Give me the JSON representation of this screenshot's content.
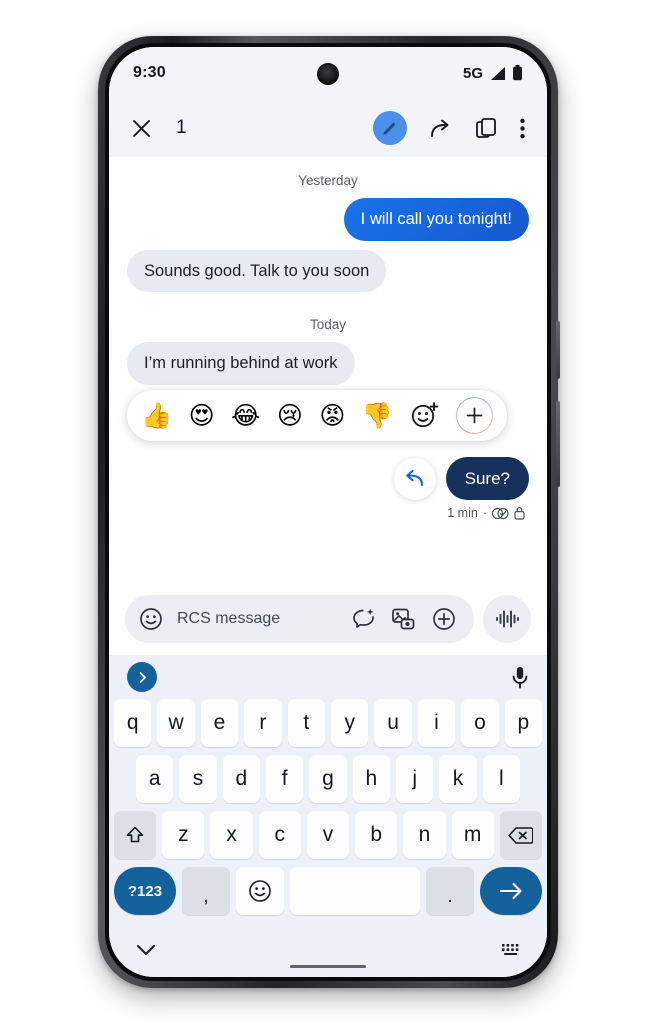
{
  "status_bar": {
    "time": "9:30",
    "network": "5G",
    "signal_icon": "signal-bars-icon",
    "battery_icon": "battery-full-icon",
    "camera": "front-camera-punch-hole"
  },
  "action_bar": {
    "close_icon": "close-x-icon",
    "selection_count": "1",
    "edit_icon": "pencil-edit-icon",
    "forward_icon": "forward-arrow-icon",
    "copy_icon": "copy-icon",
    "overflow_icon": "more-vertical-icon"
  },
  "conversation": {
    "separators": {
      "yesterday": "Yesterday",
      "today": "Today"
    },
    "messages": [
      {
        "text": "I will call you tonight!",
        "direction": "out",
        "style": "blue"
      },
      {
        "text": "Sounds good. Talk to you soon",
        "direction": "in",
        "style": "gray"
      },
      {
        "text": "I’m running behind at work",
        "direction": "in",
        "style": "gray"
      },
      {
        "text": "Sure?",
        "direction": "out",
        "style": "selected"
      }
    ],
    "reactions": {
      "emojis": [
        "👍",
        "😍",
        "😂",
        "😢",
        "😡",
        "👎"
      ],
      "emoji_names": [
        "thumbs-up",
        "heart-eyes",
        "joy",
        "cry",
        "angry",
        "thumbs-down"
      ],
      "more_emoji_icon": "emoji-plus-icon",
      "add_icon": "plus-circle-icon"
    },
    "selected_message": {
      "reply_icon": "reply-arrow-icon",
      "timestamp": "1 min",
      "separator": "·",
      "rcs_icon": "rcs-delivered-icon",
      "lock_icon": "lock-icon"
    }
  },
  "compose": {
    "emoji_icon": "smiley-icon",
    "placeholder": "RCS message",
    "magic_icon": "magic-compose-icon",
    "gallery_icon": "gallery-camera-icon",
    "plus_icon": "plus-circle-icon",
    "audio_icon": "audio-waveform-icon"
  },
  "keyboard": {
    "suggestion_chip_icon": "chevron-right-icon",
    "mic_icon": "microphone-icon",
    "row1": [
      "q",
      "w",
      "e",
      "r",
      "t",
      "y",
      "u",
      "i",
      "o",
      "p"
    ],
    "row2": [
      "a",
      "s",
      "d",
      "f",
      "g",
      "h",
      "j",
      "k",
      "l"
    ],
    "row3": [
      "z",
      "x",
      "c",
      "v",
      "b",
      "n",
      "m"
    ],
    "shift_icon": "shift-icon",
    "backspace_icon": "backspace-icon",
    "numbers_label": "?123",
    "comma_label": ",",
    "emoji_key_icon": "smiley-icon",
    "space_label": "",
    "period_label": ".",
    "send_icon": "send-arrow-icon",
    "hide_icon": "chevron-down-icon",
    "switch_icon": "keyboard-switch-icon"
  },
  "colors": {
    "accent_blue": "#1a73e8",
    "selected_navy": "#16325c",
    "key_blue": "#14629b",
    "bubble_gray": "#e8eaf1",
    "screen_bg": "#f3f4f9"
  }
}
